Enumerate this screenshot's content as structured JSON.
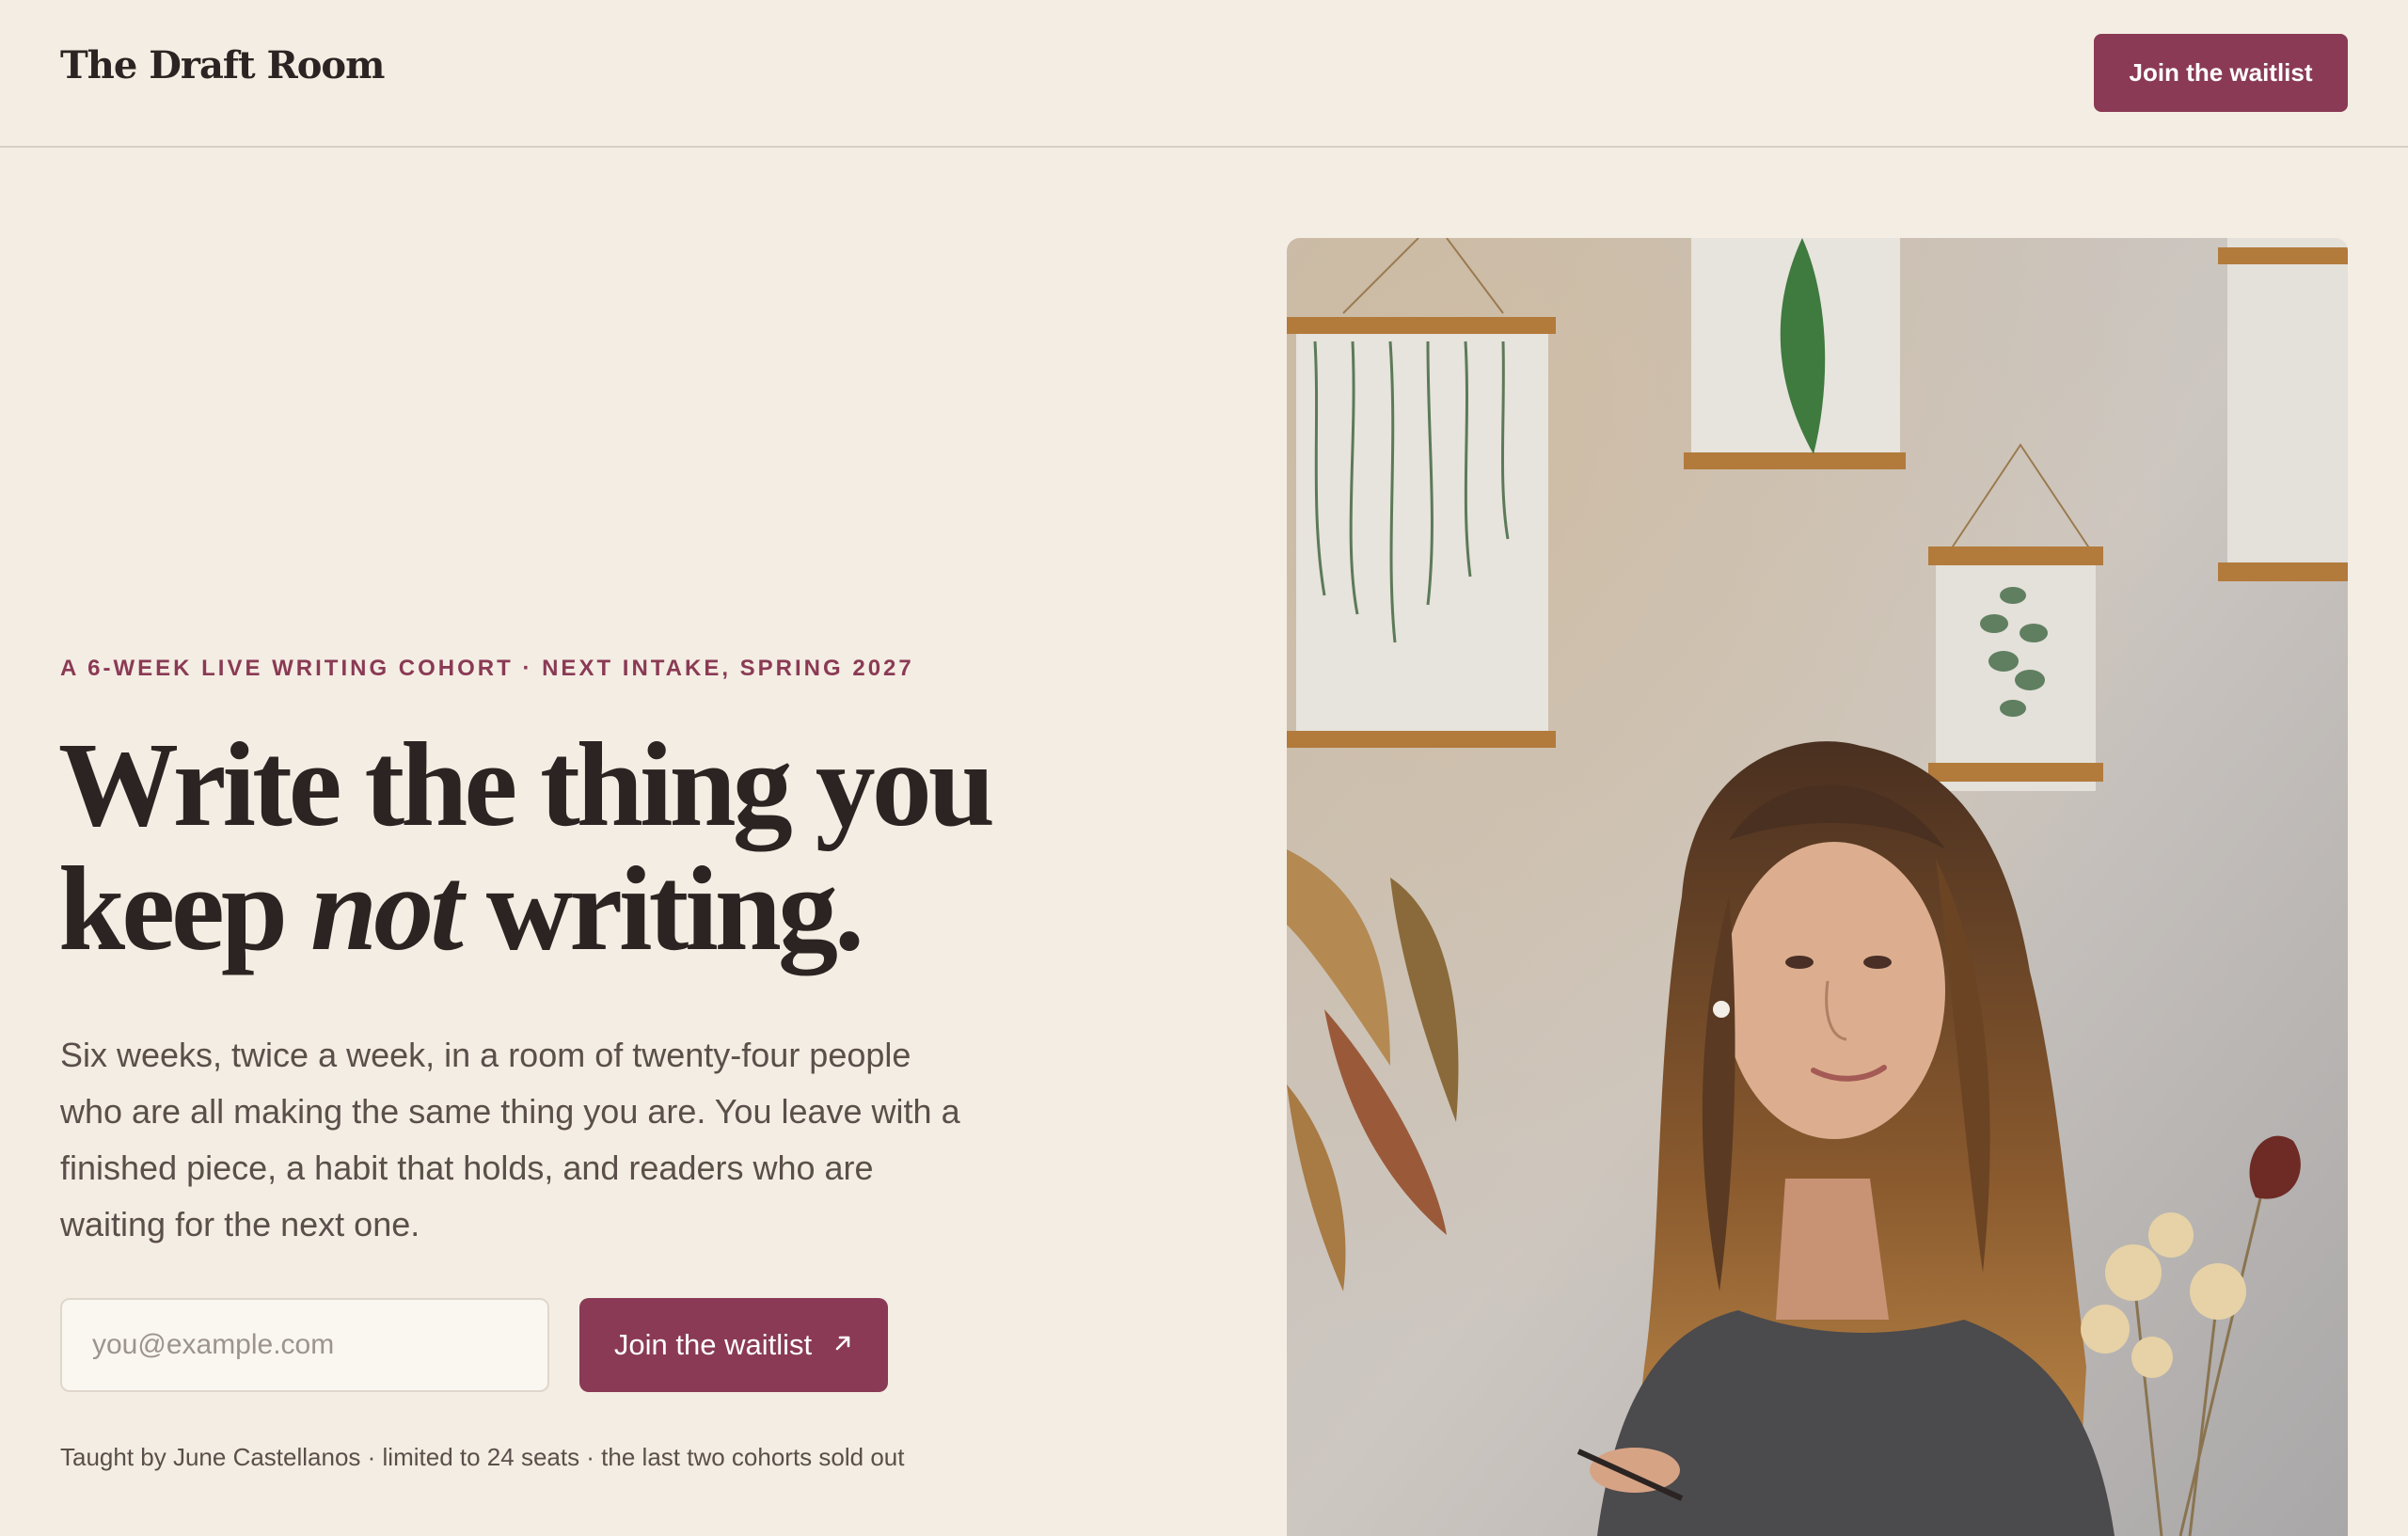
{
  "header": {
    "brand": "The Draft Room",
    "cta_label": "Join the waitlist"
  },
  "hero": {
    "eyebrow": "A 6-WEEK LIVE WRITING COHORT · NEXT INTAKE, SPRING 2027",
    "headline_line1": "Write the thing you",
    "headline_line2_before": "keep ",
    "headline_line2_em": "not",
    "headline_line2_after": " writing.",
    "lede": "Six weeks, twice a week, in a room of twenty-four people who are all making the same thing you are. You leave with a finished piece, a habit that holds, and readers who are waiting for the next one.",
    "email_placeholder": "you@example.com",
    "email_value": "",
    "submit_label": "Join the waitlist",
    "submit_icon": "arrow-up-right-icon",
    "footnote": "Taught by June Castellanos · limited to 24 seats · the last two cohorts sold out"
  },
  "photo": {
    "subject": "instructor-portrait"
  },
  "colors": {
    "background": "#f4ede3",
    "accent": "#8a3a55",
    "text": "#2b2422",
    "muted": "#5a4f4a"
  }
}
